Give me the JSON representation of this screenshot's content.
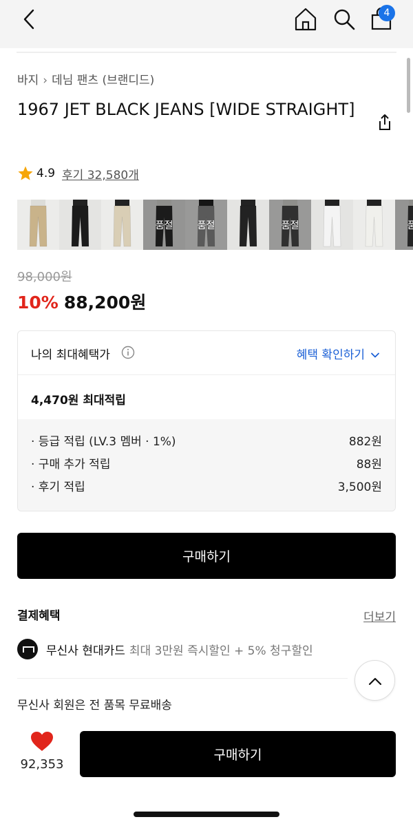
{
  "header": {
    "cart_count": "4"
  },
  "breadcrumb": {
    "level1": "바지",
    "level2": "데님 팬츠 (브랜디드)"
  },
  "product": {
    "title": "1967 JET BLACK JEANS [WIDE STRAIGHT]",
    "rating": "4.9",
    "review_text": "후기 32,580개",
    "original_price": "98,000원",
    "discount": "10%",
    "price": "88,200원"
  },
  "thumbnails": [
    {
      "color": "#c9b38a",
      "soldout": false
    },
    {
      "color": "#1b1b1b",
      "soldout": false
    },
    {
      "color": "#d9ceb5",
      "soldout": false
    },
    {
      "color": "#2a2a2a",
      "soldout": true
    },
    {
      "color": "#8a8a8a",
      "soldout": true
    },
    {
      "color": "#222222",
      "soldout": false
    },
    {
      "color": "#4a4a4a",
      "soldout": true
    },
    {
      "color": "#f4f4f4",
      "soldout": false
    },
    {
      "color": "#f0f0ec",
      "soldout": false
    },
    {
      "color": "#3a3a3a",
      "soldout": true
    }
  ],
  "soldout_label": "품절",
  "benefits": {
    "label": "나의 최대혜택가",
    "check_label": "혜택 확인하기",
    "max_points": "4,470원 최대적립",
    "items": [
      {
        "name": "· 등급 적립 (LV.3 멤버 · 1%)",
        "value": "882원"
      },
      {
        "name": "· 구매 추가 적립",
        "value": "88원"
      },
      {
        "name": "· 후기 적립",
        "value": "3,500원"
      }
    ]
  },
  "buy_label": "구매하기",
  "payment": {
    "title": "결제혜택",
    "more": "더보기",
    "card_name": "무신사 현대카드",
    "card_desc": "최대 3만원 즉시할인 + 5% 청구할인"
  },
  "shipping": "무신사 회원은 전 품목 무료배송",
  "bottom": {
    "likes": "92,353",
    "buy_label": "구매하기"
  },
  "colors": {
    "accent": "#1a5fd6",
    "discount": "#e1251b",
    "heart": "#e1251b",
    "badge": "#1a73e8"
  }
}
